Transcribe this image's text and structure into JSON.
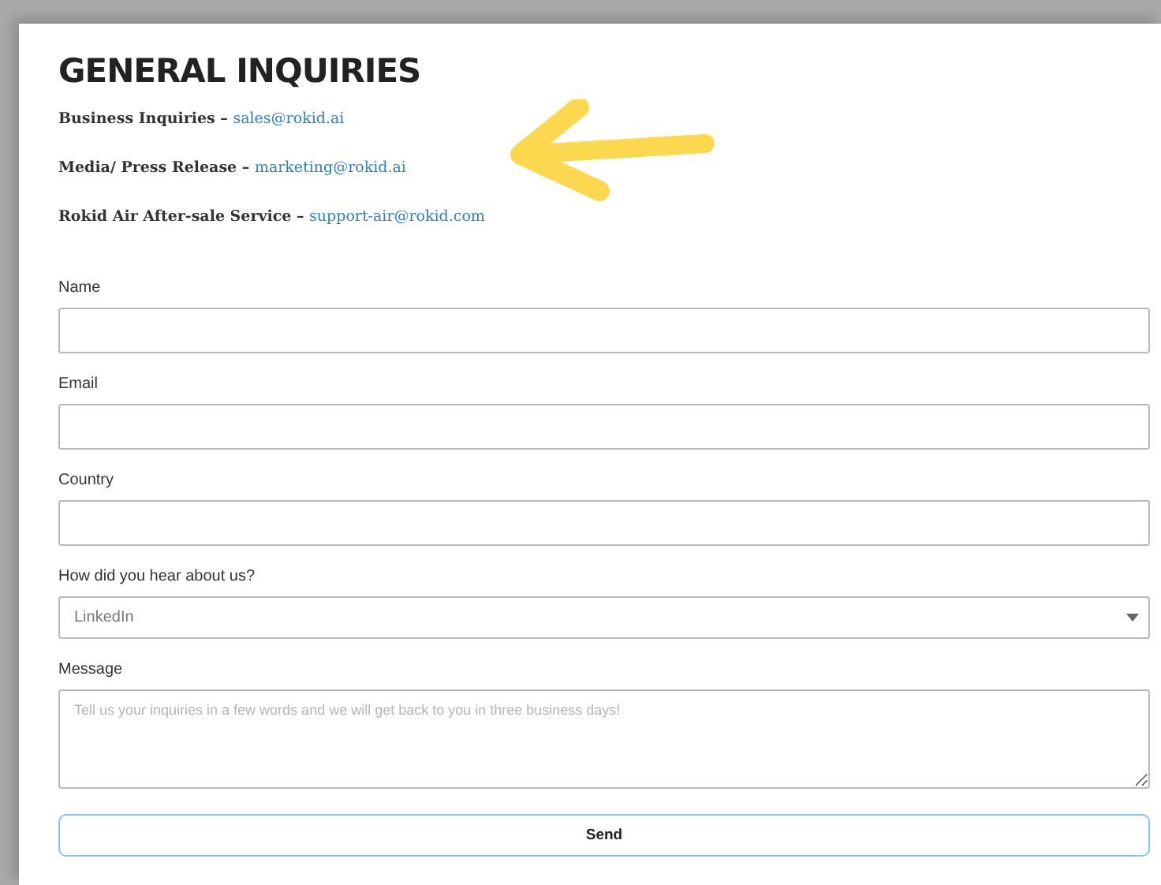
{
  "title": "GENERAL INQUIRIES",
  "contacts": [
    {
      "label": "Business Inquiries –",
      "email": "sales@rokid.ai"
    },
    {
      "label": "Media/ Press Release –",
      "email": "marketing@rokid.ai"
    },
    {
      "label": "Rokid Air After-sale Service –",
      "email": "support-air@rokid.com"
    }
  ],
  "fields": [
    {
      "kind": "text",
      "label": "Name"
    },
    {
      "kind": "text",
      "label": "Email"
    },
    {
      "kind": "text",
      "label": "Country"
    },
    {
      "kind": "select",
      "label": "How did you hear about us?",
      "value": "LinkedIn"
    },
    {
      "kind": "textarea",
      "label": "Message",
      "placeholder": "Tell us your inquiries in a few words and we will get back to you in three business days!"
    }
  ],
  "submit": "Send"
}
